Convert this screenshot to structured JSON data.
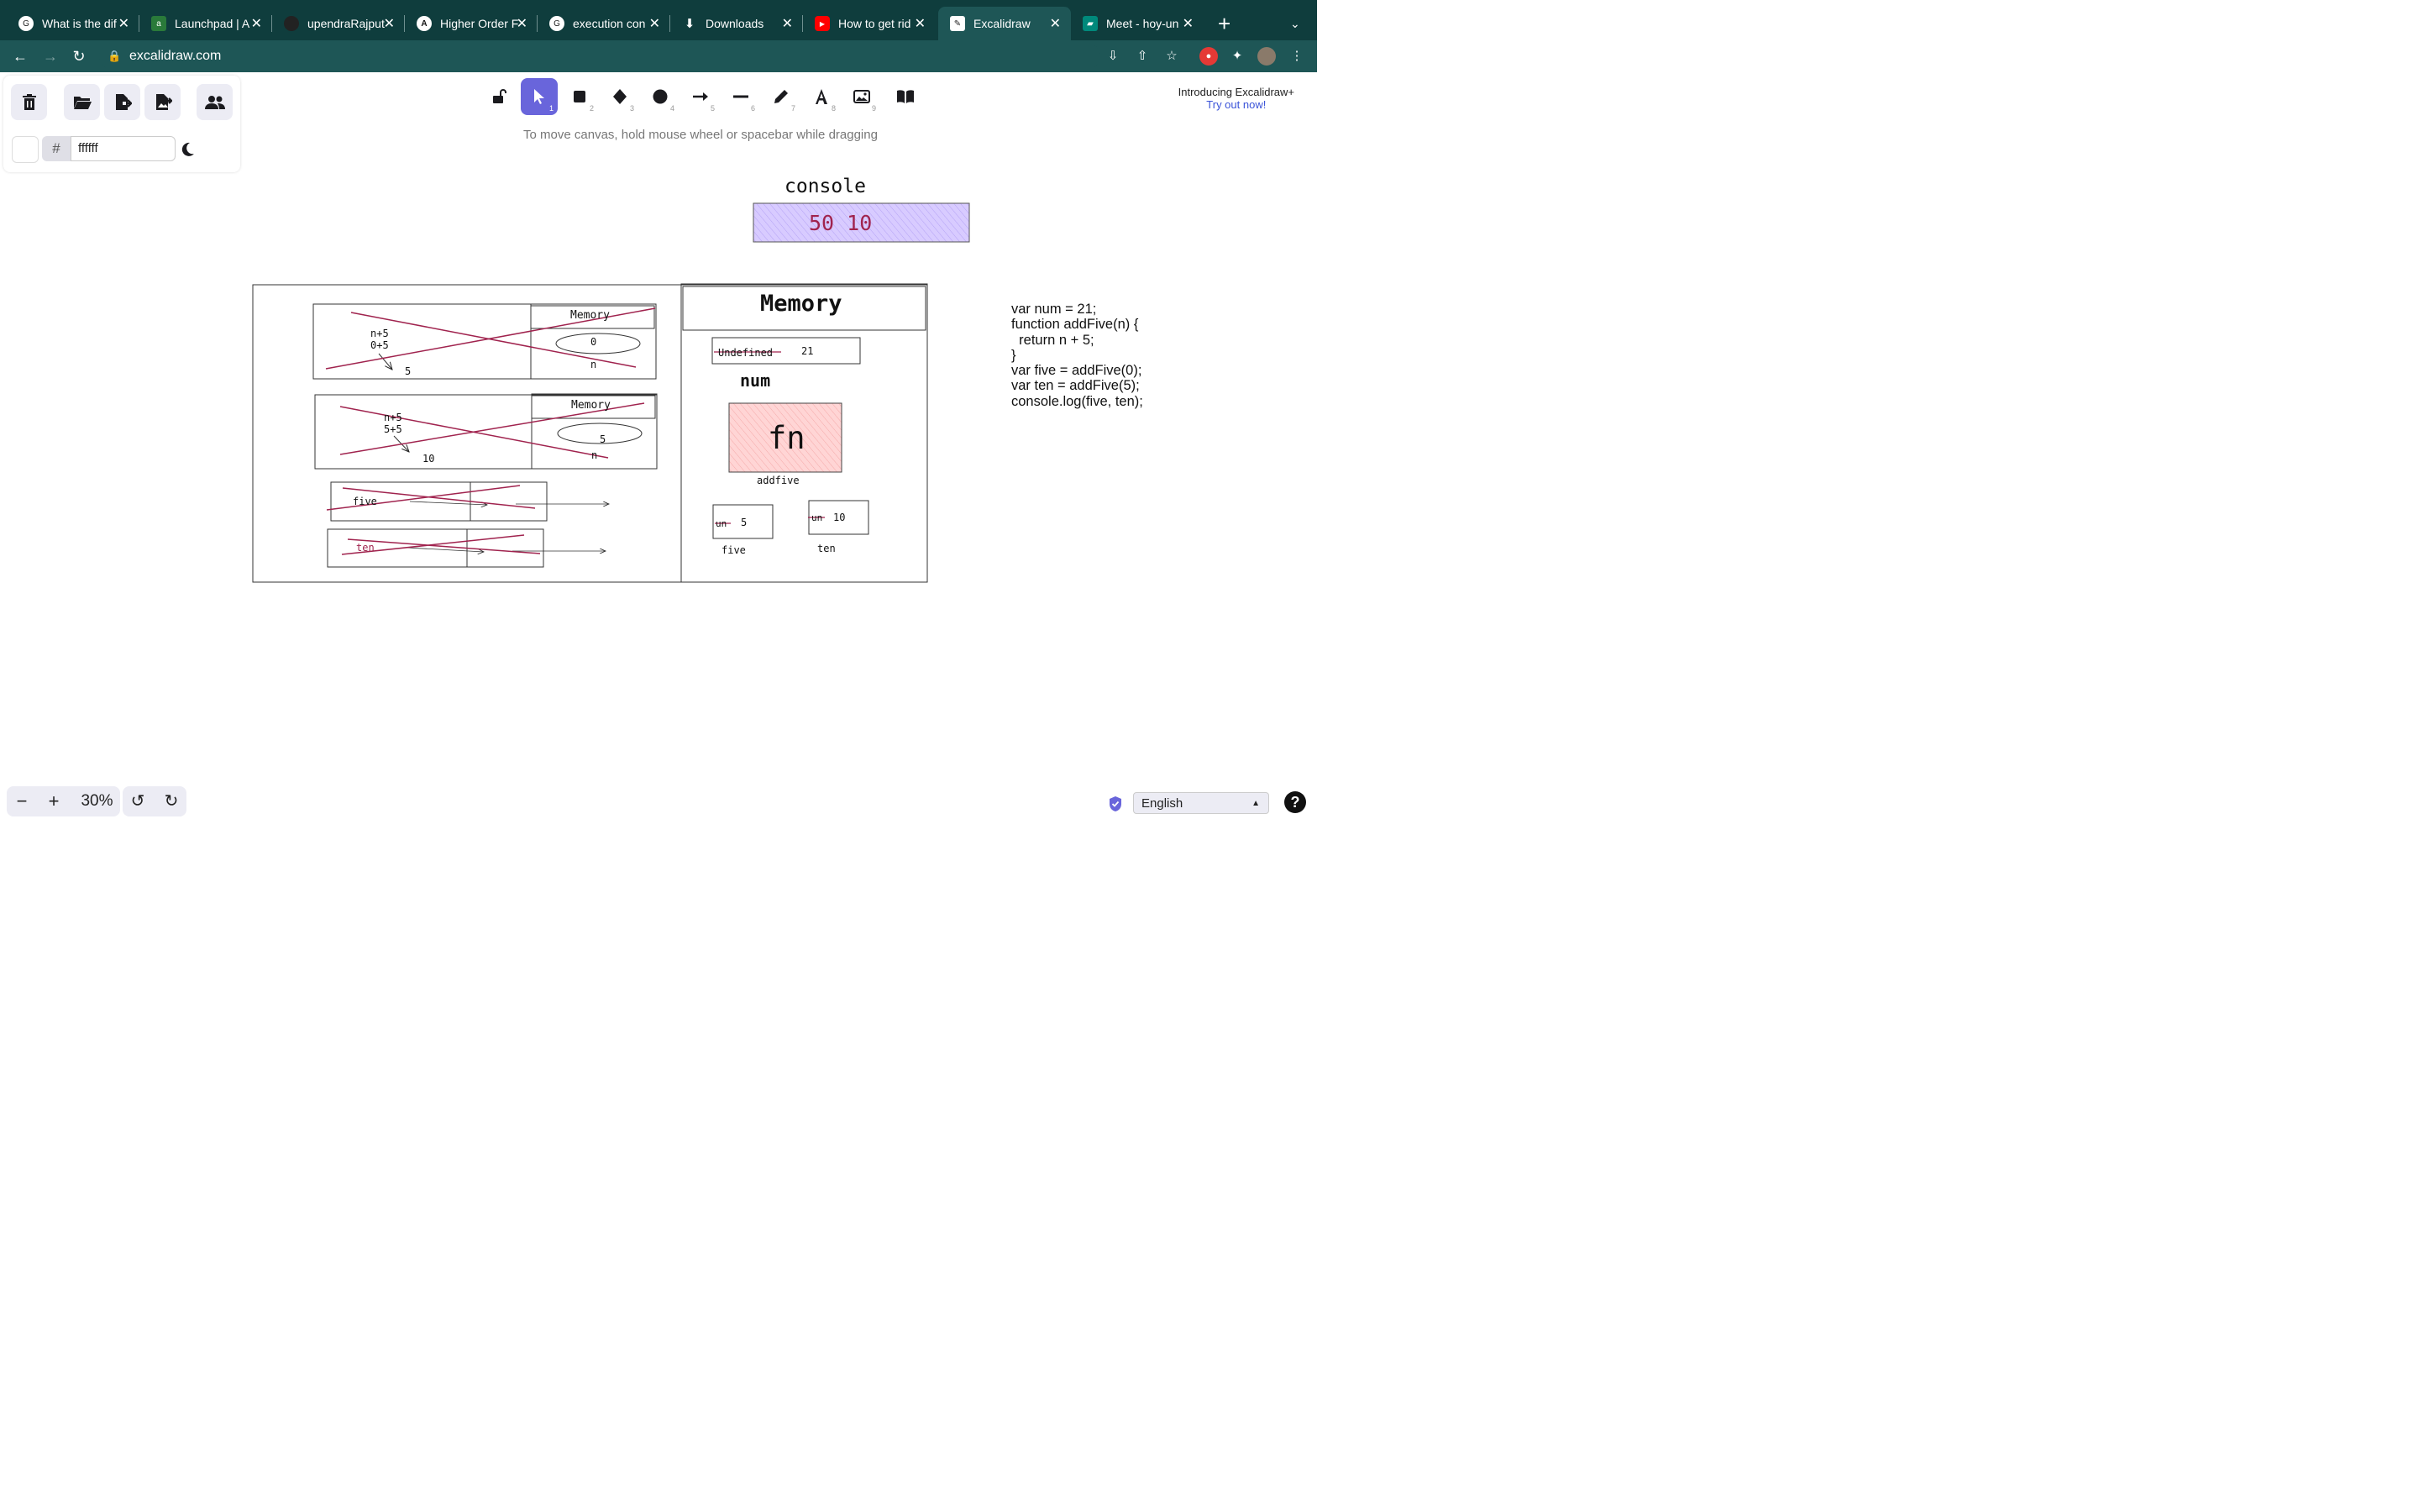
{
  "browser": {
    "tabs": [
      {
        "title": "What is the dif",
        "icon": "google-icon"
      },
      {
        "title": "Launchpad | A",
        "icon": "altcampus-icon"
      },
      {
        "title": "upendraRajput",
        "icon": "github-icon"
      },
      {
        "title": "Higher Order F",
        "icon": "altcampus-a-icon"
      },
      {
        "title": "execution con",
        "icon": "google-icon"
      },
      {
        "title": "Downloads",
        "icon": "download-icon"
      },
      {
        "title": "How to get rid",
        "icon": "youtube-icon"
      },
      {
        "title": "Excalidraw",
        "icon": "excalidraw-icon"
      },
      {
        "title": "Meet - hoy-un",
        "icon": "meet-icon"
      }
    ],
    "new_tab_label": "+",
    "url": "excalidraw.com"
  },
  "left_panel": {
    "hash_symbol": "#",
    "background_hex": "ffffff"
  },
  "toolbar": {
    "tool_numbers": [
      "1",
      "2",
      "3",
      "4",
      "5",
      "6",
      "7",
      "8",
      "9"
    ],
    "active_tool": "selection",
    "hint": "To move canvas, hold mouse wheel or spacebar while dragging"
  },
  "promo": {
    "line1": "Introducing Excalidraw+",
    "link": "Try out now!"
  },
  "canvas": {
    "console_label": "console",
    "console_output": "50 10",
    "memory_title": "Memory",
    "num_old": "Undefined",
    "num_value": "21",
    "num_label": "num",
    "fn_label": "fn",
    "addfive_label": "addfive",
    "five_old": "un",
    "five_value": "5",
    "five_label": "five",
    "ten_old": "un",
    "ten_value": "10",
    "ten_label": "ten",
    "ctx1": {
      "line1": "n+5",
      "line2": "0+5",
      "result": "5",
      "memory": "Memory",
      "param_value": "0",
      "param_name": "n"
    },
    "ctx2": {
      "line1": "n+5",
      "line2": "5+5",
      "result": "10",
      "memory": "Memory",
      "param_value": "5",
      "param_name": "n"
    },
    "gec_five": "five",
    "gec_ten": "ten",
    "code": "var num = 21;\nfunction addFive(n) {\n  return n + 5;\n}\nvar five = addFive(0);\nvar ten = addFive(5);\nconsole.log(five, ten);",
    "accent_color": "#a0234e",
    "console_fill": "#d0bfff",
    "fn_fill": "#ffc9c9"
  },
  "footer": {
    "zoom_minus": "−",
    "zoom_plus": "+",
    "zoom": "30%",
    "language": "English",
    "help": "?"
  }
}
